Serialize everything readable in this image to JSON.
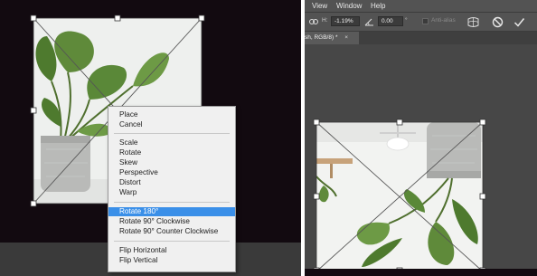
{
  "context_menu": {
    "items": [
      {
        "label": "Place"
      },
      {
        "label": "Cancel"
      },
      {
        "label": "Scale"
      },
      {
        "label": "Rotate"
      },
      {
        "label": "Skew"
      },
      {
        "label": "Perspective"
      },
      {
        "label": "Distort"
      },
      {
        "label": "Warp"
      },
      {
        "label": "Rotate 180°",
        "selected": true
      },
      {
        "label": "Rotate 90° Clockwise"
      },
      {
        "label": "Rotate 90° Counter Clockwise"
      },
      {
        "label": "Flip Horizontal"
      },
      {
        "label": "Flip Vertical"
      }
    ]
  },
  "menubar": {
    "items": [
      "View",
      "Window",
      "Help"
    ]
  },
  "options_bar": {
    "h_label": "H:",
    "h_value": "-1.19%",
    "angle_value": "0.00",
    "angle_unit": "°",
    "anti_alias_label": "Anti-alias"
  },
  "document_tab": {
    "label": "sh, RGB/8) *",
    "close_glyph": "×"
  },
  "icons": {
    "link": "link-icon",
    "angle": "angle-icon",
    "warp": "warp-mode-icon",
    "cancel": "cancel-transform-icon",
    "commit": "commit-transform-icon"
  },
  "colors": {
    "selection_highlight": "#3a8fe8",
    "canvas_dark": "#120a10",
    "leaf_green": "#5f8a3a"
  }
}
